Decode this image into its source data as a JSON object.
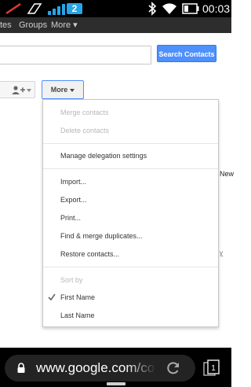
{
  "status_bar": {
    "network_badge": "2",
    "time": "00:03",
    "icons": [
      "signal-off-icon",
      "phone-outline-icon",
      "signal-bars-icon",
      "bluetooth-icon",
      "wifi-icon",
      "battery-icon"
    ]
  },
  "topbar": {
    "items": [
      "tes",
      "Groups",
      "More ▾"
    ]
  },
  "search": {
    "value": "",
    "button_label": "Search Contacts"
  },
  "toolbar": {
    "more_label": "More"
  },
  "menu": {
    "merge": "Merge contacts",
    "delete": "Delete contacts",
    "delegation": "Manage delegation settings",
    "import": "Import...",
    "export": "Export...",
    "print": "Print...",
    "find_merge": "Find & merge duplicates...",
    "restore": "Restore contacts...",
    "sort_header": "Sort by",
    "first_name": "First Name",
    "last_name": "Last Name",
    "selected_sort": "First Name"
  },
  "background": {
    "fragment_new": "New",
    "fragment_link": "y"
  },
  "browser": {
    "url": "www.google.com/cont"
  },
  "colors": {
    "accent": "#4d90fe",
    "badge": "#26a6e8",
    "topbar": "#2d2d2d"
  }
}
